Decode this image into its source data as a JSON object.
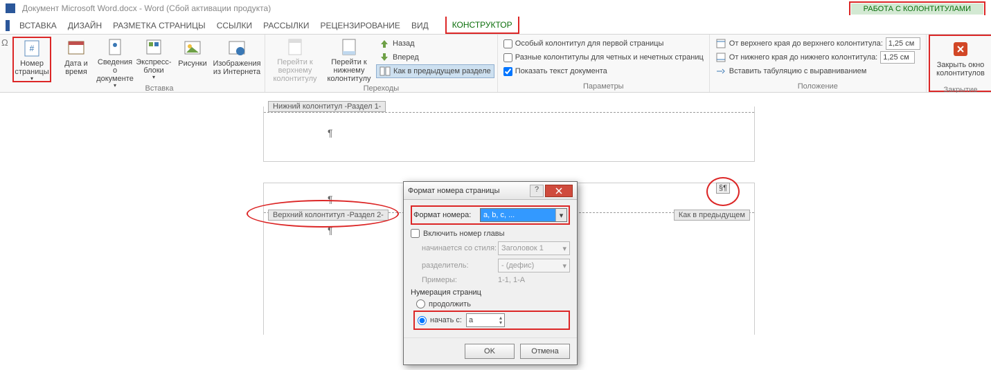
{
  "titlebar": {
    "title": "Документ Microsoft Word.docx - Word (Сбой активации продукта)"
  },
  "context_tab": {
    "group": "РАБОТА С КОЛОНТИТУЛАМИ",
    "tab": "КОНСТРУКТОР"
  },
  "tabs": [
    "ВСТАВКА",
    "ДИЗАЙН",
    "РАЗМЕТКА СТРАНИЦЫ",
    "ССЫЛКИ",
    "РАССЫЛКИ",
    "РЕЦЕНЗИРОВАНИЕ",
    "ВИД"
  ],
  "ribbon": {
    "page_number": "Номер страницы",
    "date_time": "Дата и время",
    "doc_info": "Сведения о документе",
    "quick_parts": "Экспресс-блоки",
    "pictures": "Рисунки",
    "online_pictures": "Изображения из Интернета",
    "group_insert": "Вставка",
    "goto_header": "Перейти к верхнему колонтитулу",
    "goto_footer": "Перейти к нижнему колонтитулу",
    "back": "Назад",
    "forward": "Вперед",
    "link_previous": "Как в предыдущем разделе",
    "group_nav": "Переходы",
    "diff_first": "Особый колонтитул для первой страницы",
    "diff_odd_even": "Разные колонтитулы для четных и нечетных страниц",
    "show_doc": "Показать текст документа",
    "group_options": "Параметры",
    "from_top": "От верхнего края до верхнего колонтитула:",
    "from_bottom": "От нижнего края до нижнего колонтитула:",
    "insert_tab": "Вставить табуляцию с выравниванием",
    "top_val": "1,25 см",
    "bottom_val": "1,25 см",
    "group_position": "Положение",
    "close": "Закрыть окно колонтитулов",
    "group_close": "Закрытие"
  },
  "doc": {
    "footer_tag": "Нижний колонтитул -Раздел 1-",
    "header_tag": "Верхний колонтитул -Раздел 2-",
    "link_prev_tag": "Как в предыдущем"
  },
  "dialog": {
    "title": "Формат номера страницы",
    "format_label": "Формат номера:",
    "format_value": "a, b, c, ...",
    "include_chapter": "Включить номер главы",
    "starts_with_style": "начинается со стиля:",
    "style_value": "Заголовок 1",
    "separator": "разделитель:",
    "separator_value": "- (дефис)",
    "examples": "Примеры:",
    "examples_value": "1-1, 1-A",
    "numbering": "Нумерация страниц",
    "continue": "продолжить",
    "start_at": "начать с:",
    "start_value": "a",
    "ok": "OK",
    "cancel": "Отмена"
  }
}
